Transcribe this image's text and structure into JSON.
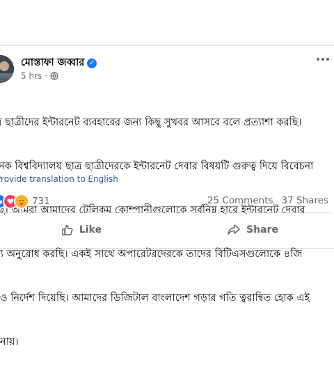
{
  "post": {
    "author": "মোস্তাফা জব্বার",
    "time": "5 hrs",
    "dot": "·",
    "more_icon": "more-horizontal-icon",
    "verified_icon": "verified-badge-icon",
    "privacy_icon": "public-globe-icon",
    "lines": [
      "ত্র ছাত্রীদের ইন্টারনেট ব্যবহারের জন্য কিছু সুখবর আসবে বলে প্রত্যাশা করছি।",
      "নেক বিশ্ববিদ্যালয় ছাত্র ছাত্রীদেরকে ইন্টারনেট দেবার বিষয়টি গুরুত্ব দিয়ে বিবেচনা",
      "ছে। আমরা আমাদের টেলিকম কোম্পানীগুলোকে সর্বনিম্ন হারে ইন্টারনেট দেবার",
      "ন্য অনুরোধ করছি। একই সাথে অপারেটরদেরকে তাদের বিটিএসগুলোকে ৪জি",
      "রও নির্দেশ দিয়েছি। আমাদের ডিজিটাল বাংলাদেশ গড়ার গতি ত্বরান্বিত হোক এই",
      "মনায়।"
    ],
    "translate_label": "Provide translation to English",
    "reaction_count": "731",
    "comments": "25 Comments",
    "shares": "37 Shares",
    "like_label": "Like",
    "share_label": "Share",
    "colors": {
      "like_blue": "#1877f2",
      "love_red": "#f33e58",
      "care_yellow": "#f7b125",
      "link": "#385898",
      "muted": "#65676b"
    }
  }
}
